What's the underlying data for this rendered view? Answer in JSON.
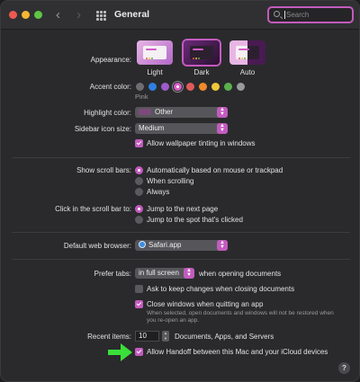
{
  "window": {
    "title": "General"
  },
  "search": {
    "placeholder": "Search"
  },
  "appearance": {
    "label": "Appearance:",
    "options": [
      "Light",
      "Dark",
      "Auto"
    ],
    "selected": "Dark"
  },
  "accent": {
    "label": "Accent color:",
    "selected_name": "Pink",
    "colors": [
      "#6e6e72",
      "#2f7fe0",
      "#9c5ccc",
      "#d860c8",
      "#e05a5a",
      "#ef8a2c",
      "#f0c53a",
      "#5ab04a",
      "#9a9a9e"
    ]
  },
  "highlight": {
    "label": "Highlight color:",
    "value": "Other"
  },
  "sidebar_icon": {
    "label": "Sidebar icon size:",
    "value": "Medium"
  },
  "wallpaper_tint": {
    "label": "Allow wallpaper tinting in windows"
  },
  "scroll_bars": {
    "label": "Show scroll bars:",
    "options": [
      "Automatically based on mouse or trackpad",
      "When scrolling",
      "Always"
    ]
  },
  "click_scroll": {
    "label": "Click in the scroll bar to:",
    "options": [
      "Jump to the next page",
      "Jump to the spot that's clicked"
    ]
  },
  "browser": {
    "label": "Default web browser:",
    "value": "Safari.app"
  },
  "tabs": {
    "label": "Prefer tabs:",
    "value": "in full screen",
    "suffix": "when opening documents"
  },
  "ask_keep": {
    "label": "Ask to keep changes when closing documents"
  },
  "close_windows": {
    "label": "Close windows when quitting an app",
    "note": "When selected, open documents and windows will not be restored when you re-open an app."
  },
  "recent": {
    "label": "Recent items:",
    "value": "10",
    "suffix": "Documents, Apps, and Servers"
  },
  "handoff": {
    "label": "Allow Handoff between this Mac and your iCloud devices"
  },
  "colors": {
    "accent": "#c35bbf",
    "arrow": "#3adf3a"
  }
}
